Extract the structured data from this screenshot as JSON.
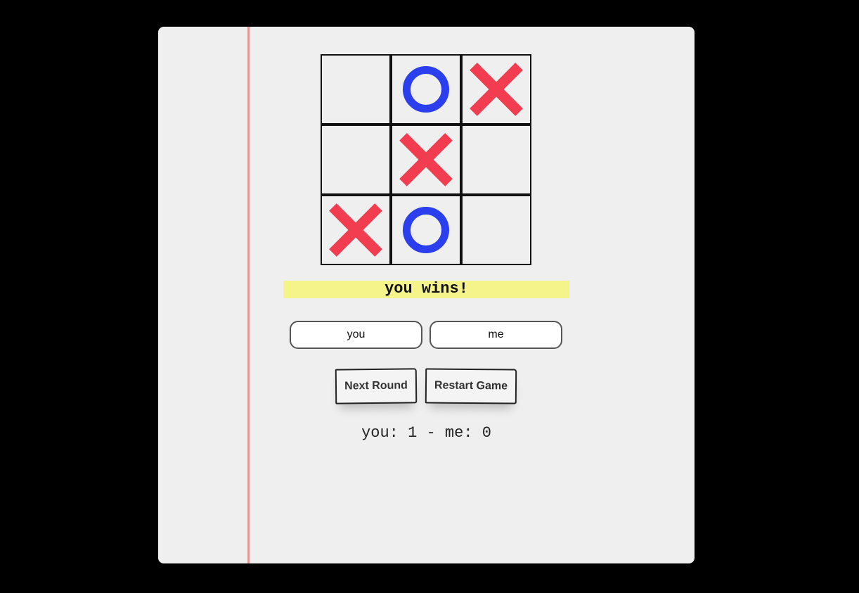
{
  "board": {
    "cells": [
      "",
      "O",
      "X",
      "",
      "X",
      "",
      "X",
      "O",
      ""
    ]
  },
  "status_text": "you wins!",
  "players": {
    "player1_value": "you",
    "player2_value": "me"
  },
  "buttons": {
    "next_round": "Next Round",
    "restart_game": "Restart Game"
  },
  "score_text": "you: 1 - me: 0",
  "colors": {
    "x_mark": "#f23c4f",
    "o_mark": "#2b3fee",
    "highlight": "#f5f578",
    "margin_line": "#e17878",
    "ruled_line": "#468caa"
  }
}
